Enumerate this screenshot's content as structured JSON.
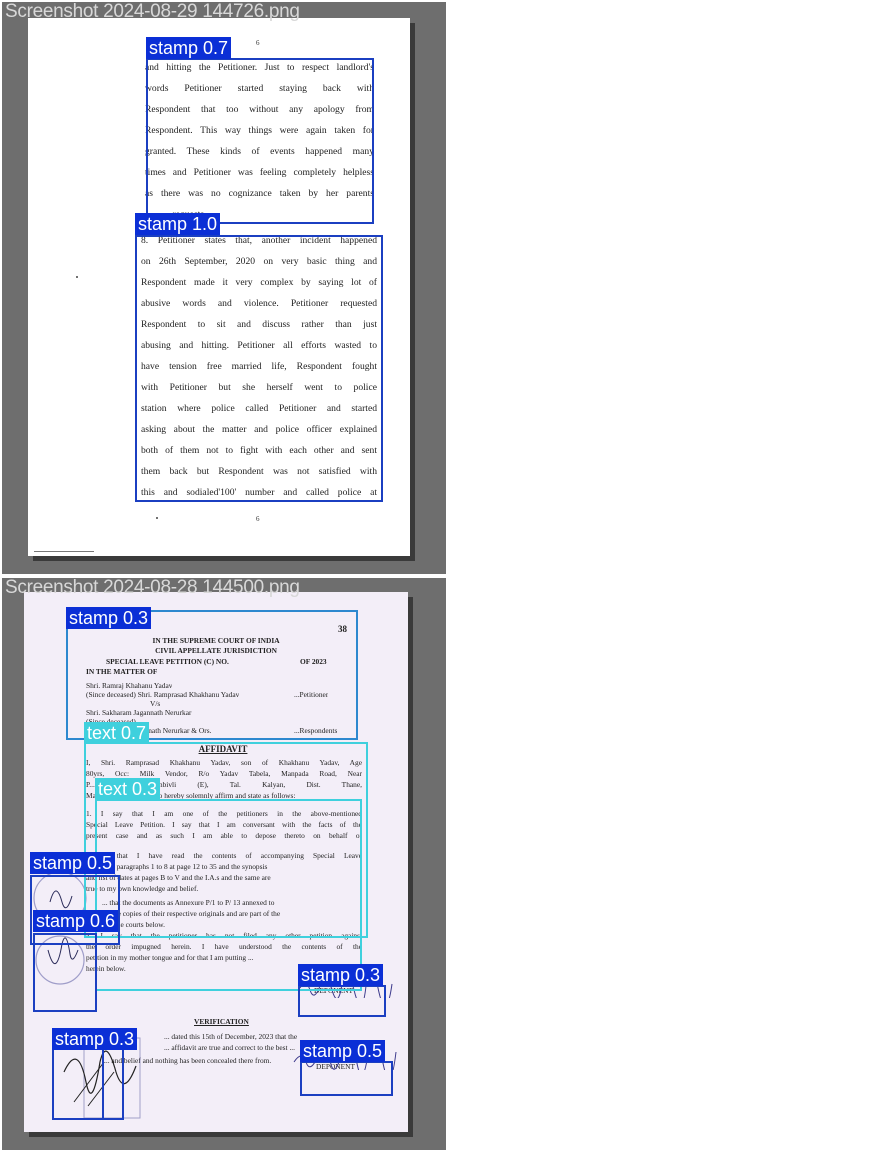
{
  "screenshot1": {
    "filename": "Screenshot 2024-08-29 144726.png",
    "page_number_top": "6",
    "page_number_bottom": "6",
    "lines": [
      "and hitting the Petitioner. Just to respect landlord's",
      "words Petitioner started staying back with",
      "Respondent that too without any apology from",
      "Respondent. This way things were again taken for",
      "granted. These kinds of events happened many",
      "times and Petitioner was feeling completely helpless",
      "as there was no cognizance taken by her parents",
      "... requests.",
      "8. Petitioner states that, another incident happened",
      "on 26th September, 2020 on very basic thing and",
      "Respondent made it very complex by saying lot of",
      "abusive words and violence. Petitioner requested",
      "Respondent to sit and discuss rather than just",
      "abusing and hitting. Petitioner all efforts wasted to",
      "have tension free married life, Respondent fought",
      "with Petitioner but she herself went to police",
      "station where police called Petitioner and started",
      "asking about the matter and police officer explained",
      "both of them not to fight with each other and sent",
      "them back but Respondent was not satisfied with",
      "this and sodialed'100' number and called police at"
    ],
    "detections": [
      {
        "label": "stamp 0.7"
      },
      {
        "label": "stamp 1.0"
      }
    ]
  },
  "screenshot2": {
    "filename": "Screenshot 2024-08-28 144500.png",
    "page_number": "38",
    "header": {
      "court": "IN THE SUPREME COURT OF INDIA",
      "jurisdiction": "CIVIL APPELLATE JURISDICTION",
      "petition": "SPECIAL LEAVE PETITION (C) NO.",
      "year": "OF 2023",
      "matter": "IN THE MATTER OF"
    },
    "parties": [
      "Shri. Ramraj Khahanu Yadav",
      "(Since deceased) Shri. Ramprasad Khakhanu Yadav",
      "V/s",
      "Shri. Sakharam Jagannath Nerurkar",
      "(Since deceased)",
      "... Jagannath Nerurkar & Ors."
    ],
    "petitioner_role": "...Petitioner",
    "respondent_role": "...Respondents",
    "affidavit_title": "AFFIDAVIT",
    "affidavit_lines": [
      "I, Shri. Ramprasad Khakhanu Yadav, son of Khakhanu Yadav, Age",
      "80yrs, Occ: Milk Vendor, R/o Yadav Tabela, Manpada Road, Near",
      "P... ...y, Dombivli (E), Tal. Kalyan, Dist. Thane,",
      "Maharashtra - 421201, do hereby solemnly affirm and state as follows:",
      "1. I say that I am one of the petitioners in the above-mentioned",
      "Special Leave Petition. I say that I am conversant with the facts of the",
      "present case and as such I am able to depose thereto on behalf of",
      "... that I have read the contents of accompanying Special Leave",
      "... at paragraphs 1 to 8 at page 12 to 35 and the synopsis",
      "and list of dates at pages B to V and the I.A.s and the same are",
      "true to my own knowledge and belief.",
      "... that the documents as Annexure P/1 to P/ 13 annexed to",
      "... true copies of their respective originals and are part of the",
      "record of the courts below.",
      "4. I say that the petitioner has not filed any other petition against",
      "the order impugned herein. I have understood the contents of the",
      "petition in my mother tongue and for that I am putting ...",
      "herein below."
    ],
    "deponent_label_1": "DEPONENT",
    "verification_title": "VERIFICATION",
    "verification_lines": [
      "... dated this 15th of December, 2023 that the",
      "... affidavit are true and correct to the best ...",
      "... and belief and nothing has been concealed there from."
    ],
    "deponent_label_2": "DEPONENT",
    "detections": [
      {
        "label": "stamp 0.3"
      },
      {
        "label": "text 0.7"
      },
      {
        "label": "text 0.3"
      },
      {
        "label": "stamp 0.5"
      },
      {
        "label": "stamp 0.6"
      },
      {
        "label": "stamp 0.3"
      },
      {
        "label": "stamp 0.3"
      },
      {
        "label": "stamp 0.5"
      }
    ]
  },
  "colors": {
    "stamp_box": "#1b3fc1",
    "stamp_label_bg": "#0b2fd6",
    "text_box": "#3fd0dd",
    "viewer_bg": "#6e6e6e"
  }
}
